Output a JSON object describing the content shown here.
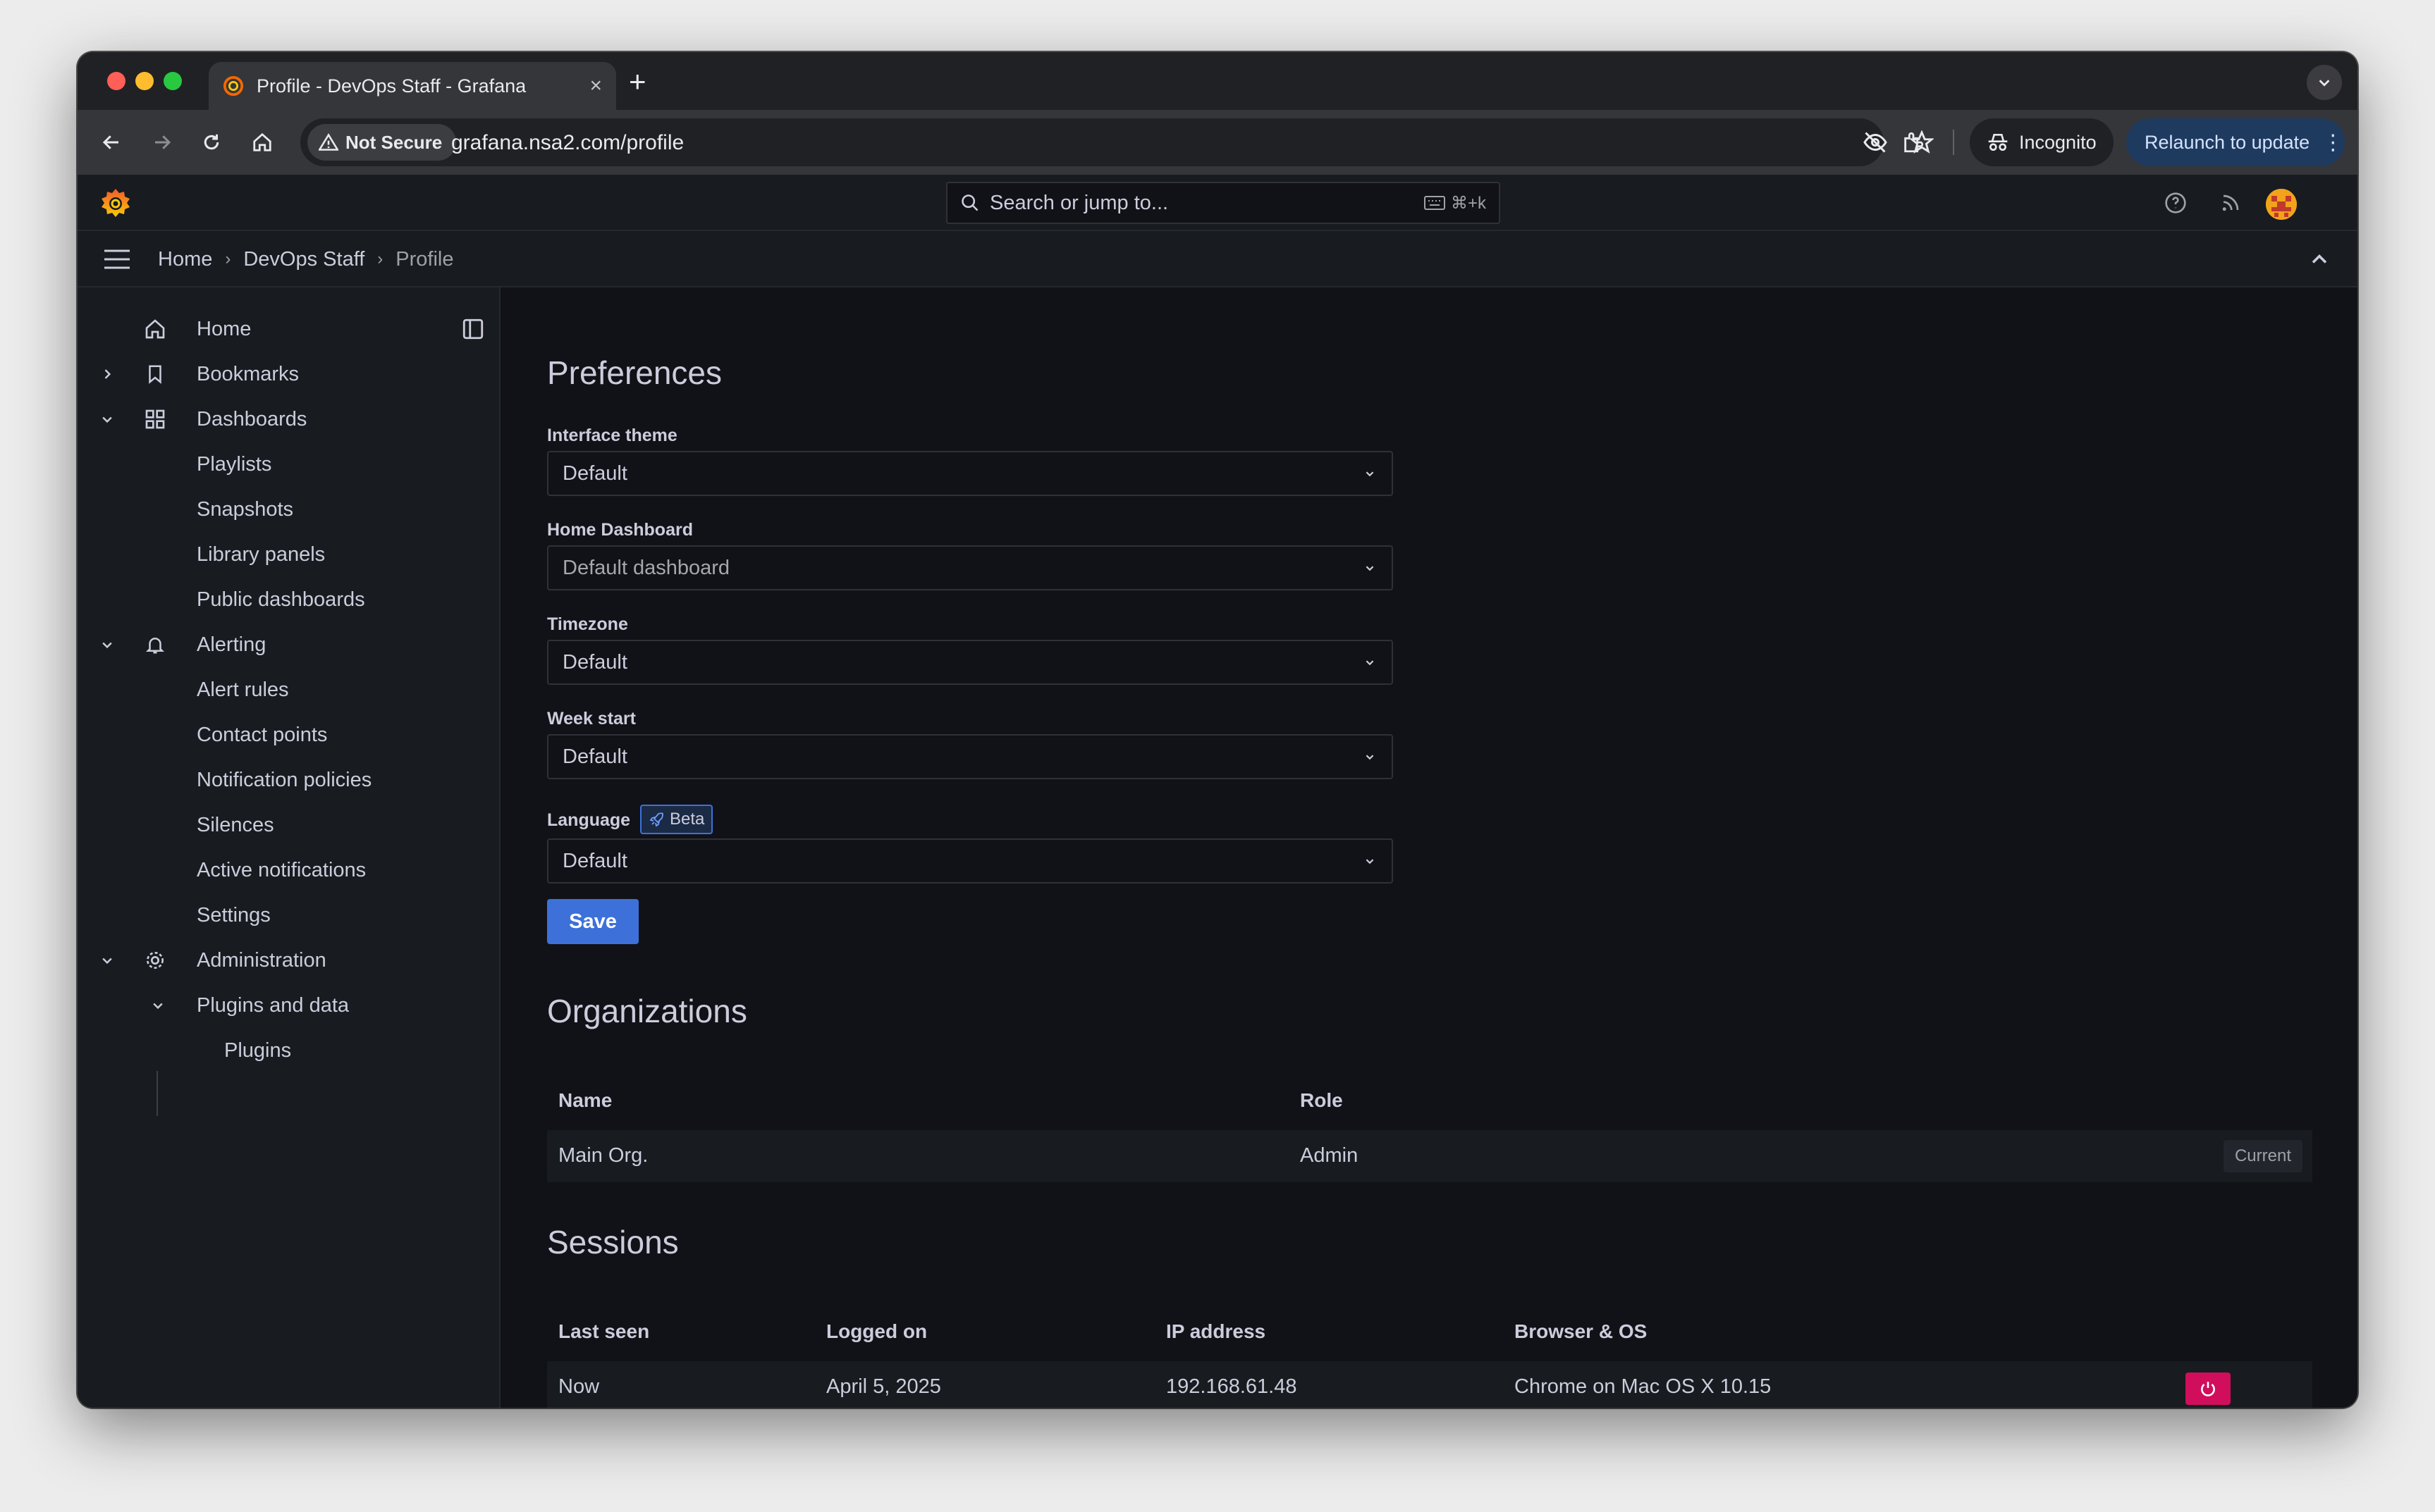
{
  "browser": {
    "tab_title": "Profile - DevOps Staff - Grafana",
    "tab_close": "×",
    "new_tab": "+",
    "security_label": "Not Secure",
    "url": "grafana.nsa2.com/profile",
    "incognito_label": "Incognito",
    "relaunch_label": "Relaunch to update",
    "relaunch_menu": "⋮"
  },
  "topbar": {
    "search_placeholder": "Search or jump to...",
    "search_shortcut": "⌘+k"
  },
  "breadcrumb": {
    "items": [
      "Home",
      "DevOps Staff",
      "Profile"
    ],
    "separator": "›"
  },
  "sidebar": {
    "items": [
      {
        "label": "Home",
        "icon": "home-icon"
      },
      {
        "label": "Bookmarks",
        "icon": "bookmark-icon",
        "caret": "right"
      },
      {
        "label": "Dashboards",
        "icon": "apps-icon",
        "caret": "down"
      },
      {
        "label": "Playlists"
      },
      {
        "label": "Snapshots"
      },
      {
        "label": "Library panels"
      },
      {
        "label": "Public dashboards"
      },
      {
        "label": "Alerting",
        "icon": "bell-icon",
        "caret": "down"
      },
      {
        "label": "Alert rules"
      },
      {
        "label": "Contact points"
      },
      {
        "label": "Notification policies"
      },
      {
        "label": "Silences"
      },
      {
        "label": "Active notifications"
      },
      {
        "label": "Settings"
      },
      {
        "label": "Administration",
        "icon": "cog-icon",
        "caret": "down"
      },
      {
        "label": "Plugins and data",
        "caret": "down"
      },
      {
        "label": "Plugins"
      }
    ]
  },
  "preferences": {
    "title": "Preferences",
    "fields": [
      {
        "label": "Interface theme",
        "value": "Default"
      },
      {
        "label": "Home Dashboard",
        "value": "Default dashboard"
      },
      {
        "label": "Timezone",
        "value": "Default"
      },
      {
        "label": "Week start",
        "value": "Default"
      },
      {
        "label": "Language",
        "value": "Default",
        "badge": "Beta"
      }
    ],
    "save_label": "Save"
  },
  "organizations": {
    "title": "Organizations",
    "headers": [
      "Name",
      "Role"
    ],
    "rows": [
      {
        "name": "Main Org.",
        "role": "Admin",
        "status": "Current"
      }
    ]
  },
  "sessions": {
    "title": "Sessions",
    "headers": [
      "Last seen",
      "Logged on",
      "IP address",
      "Browser & OS"
    ],
    "rows": [
      {
        "last_seen": "Now",
        "logged_on": "April 5, 2025",
        "ip": "192.168.61.48",
        "browser": "Chrome on Mac OS X 10.15"
      }
    ]
  },
  "colors": {
    "primary": "#3d71d9",
    "danger": "#d10e5c",
    "background": "#111217",
    "panel": "#181b1f",
    "text": "#ccccdc"
  }
}
